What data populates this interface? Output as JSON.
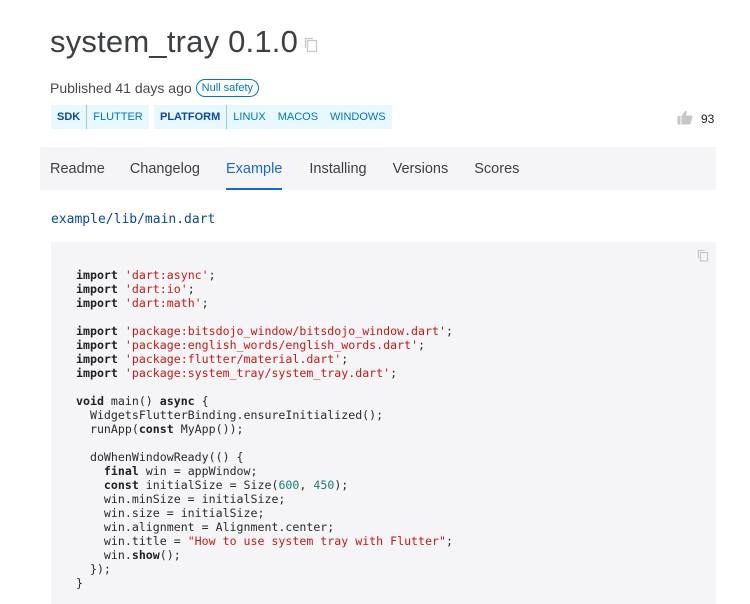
{
  "header": {
    "title": "system_tray 0.1.0",
    "published": "Published 41 days ago",
    "null_safety_badge": "Null safety"
  },
  "tags": [
    {
      "label": "SDK",
      "values": [
        "FLUTTER"
      ]
    },
    {
      "label": "PLATFORM",
      "values": [
        "LINUX",
        "MACOS",
        "WINDOWS"
      ]
    }
  ],
  "likes": {
    "count": "93",
    "icon": "thumbs-up-icon"
  },
  "tabs": [
    {
      "label": "Readme",
      "active": false
    },
    {
      "label": "Changelog",
      "active": false
    },
    {
      "label": "Example",
      "active": true
    },
    {
      "label": "Installing",
      "active": false
    },
    {
      "label": "Versions",
      "active": false
    },
    {
      "label": "Scores",
      "active": false
    }
  ],
  "example_path": "example/lib/main.dart",
  "code": {
    "imports_core": [
      "'dart:async'",
      "'dart:io'",
      "'dart:math'"
    ],
    "imports_pkg": [
      "'package:bitsdojo_window/bitsdojo_window.dart'",
      "'package:english_words/english_words.dart'",
      "'package:flutter/material.dart'",
      "'package:system_tray/system_tray.dart'"
    ],
    "kw_import": "import",
    "kw_void": "void",
    "kw_async": "async",
    "kw_const": "const",
    "kw_final": "final",
    "main_sig": " main() ",
    "brace_open": " {",
    "line_binding": "  WidgetsFlutterBinding.ensureInitialized();",
    "line_runapp_a": "  runApp(",
    "line_runapp_b": " MyApp());",
    "line_dowhen": "  doWhenWindowReady(() {",
    "line_final_b": " win = appWindow;",
    "line_const_b": " initialSize = Size(",
    "size_w": "600",
    "size_h": "450",
    "line_const_c": ");",
    "line_minsize": "    win.minSize = initialSize;",
    "line_size": "    win.size = initialSize;",
    "line_align": "    win.alignment = Alignment.center;",
    "line_title_a": "    win.title = ",
    "title_str": "\"How to use system tray with Flutter\"",
    "line_show_a": "    win.",
    "show_kw": "show",
    "line_show_b": "();",
    "line_close1": "  });",
    "line_close2": "}"
  }
}
